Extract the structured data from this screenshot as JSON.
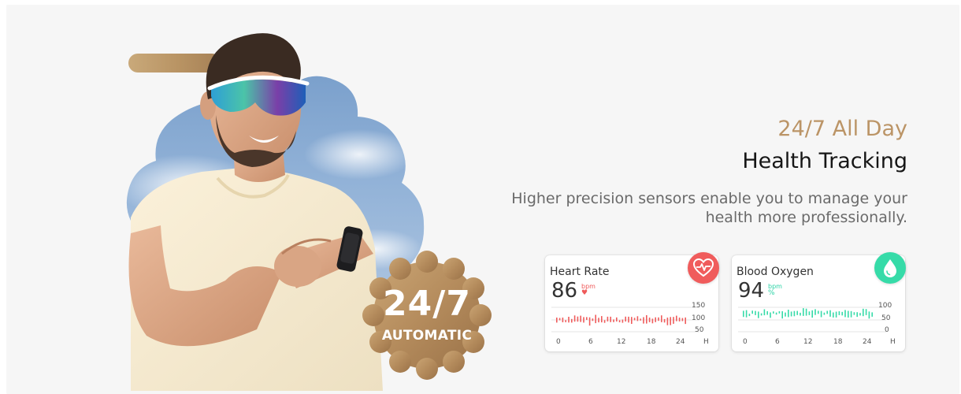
{
  "headline": {
    "line1": "24/7 All Day",
    "line2": "Health Tracking",
    "subtitle": "Higher precision sensors enable you to manage your health more professionally."
  },
  "badge": {
    "big": "24/7",
    "small": "AUTOMATIC"
  },
  "cards": {
    "heart_rate": {
      "title": "Heart Rate",
      "value": "86",
      "unit": "bpm",
      "icon": "heart-rate-icon",
      "color": "#f05c5c",
      "y_ticks": [
        "150",
        "100",
        "50"
      ],
      "x_ticks": [
        "0",
        "6",
        "12",
        "18",
        "24",
        "H"
      ]
    },
    "blood_oxygen": {
      "title": "Blood Oxygen",
      "value": "94",
      "unit_top": "bpm",
      "unit": "%",
      "icon": "water-drop-icon",
      "color": "#36dba8",
      "y_ticks": [
        "100",
        "50",
        "0"
      ],
      "x_ticks": [
        "0",
        "6",
        "12",
        "18",
        "24",
        "H"
      ]
    }
  },
  "colors": {
    "gold": "#bb9466",
    "heading_dark": "#161616",
    "subtitle": "#6a6a6a",
    "background": "#f6f6f6"
  }
}
